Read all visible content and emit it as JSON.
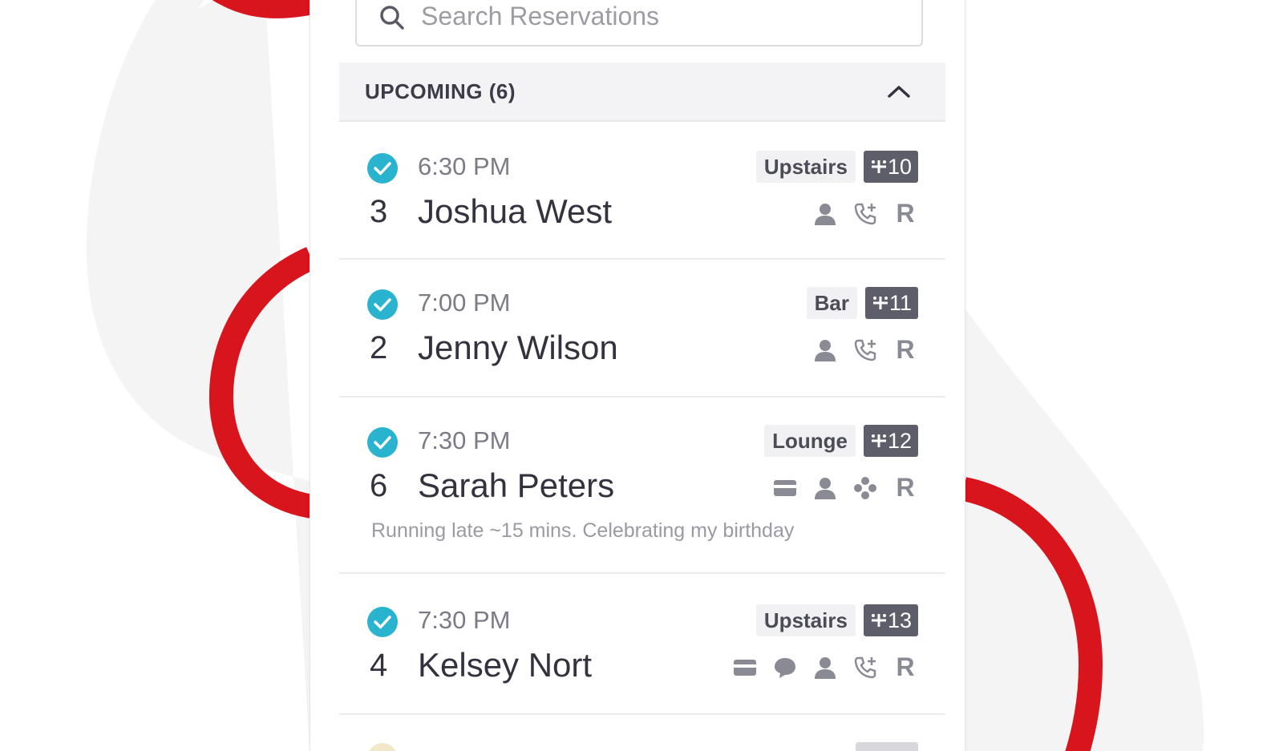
{
  "search": {
    "placeholder": "Search Reservations",
    "icon": "search-icon"
  },
  "section": {
    "title": "UPCOMING (6)",
    "toggle_icon": "chevron-up-icon"
  },
  "colors": {
    "accent_red": "#d8141c",
    "check_teal": "#2ab3cf",
    "table_badge": "#5e5e6a"
  },
  "reservations": [
    {
      "time": "6:30 PM",
      "party": "3",
      "name": "Joshua West",
      "area": "Upstairs",
      "table": "10",
      "status_icon": "check-circle-icon",
      "icons": [
        "person-icon",
        "phone-plus-icon"
      ],
      "source": "R",
      "note": ""
    },
    {
      "time": "7:00 PM",
      "party": "2",
      "name": "Jenny Wilson",
      "area": "Bar",
      "table": "11",
      "status_icon": "check-circle-icon",
      "icons": [
        "person-icon",
        "phone-plus-icon"
      ],
      "source": "R",
      "note": ""
    },
    {
      "time": "7:30 PM",
      "party": "6",
      "name": "Sarah Peters",
      "area": "Lounge",
      "table": "12",
      "status_icon": "check-circle-icon",
      "icons": [
        "card-icon",
        "person-icon",
        "flower-icon"
      ],
      "source": "R",
      "note": "Running late ~15 mins. Celebrating my birthday"
    },
    {
      "time": "7:30 PM",
      "party": "4",
      "name": "Kelsey Nort",
      "area": "Upstairs",
      "table": "13",
      "status_icon": "check-circle-icon",
      "icons": [
        "card-icon",
        "chat-icon",
        "person-icon",
        "phone-plus-icon"
      ],
      "source": "R",
      "note": ""
    }
  ]
}
